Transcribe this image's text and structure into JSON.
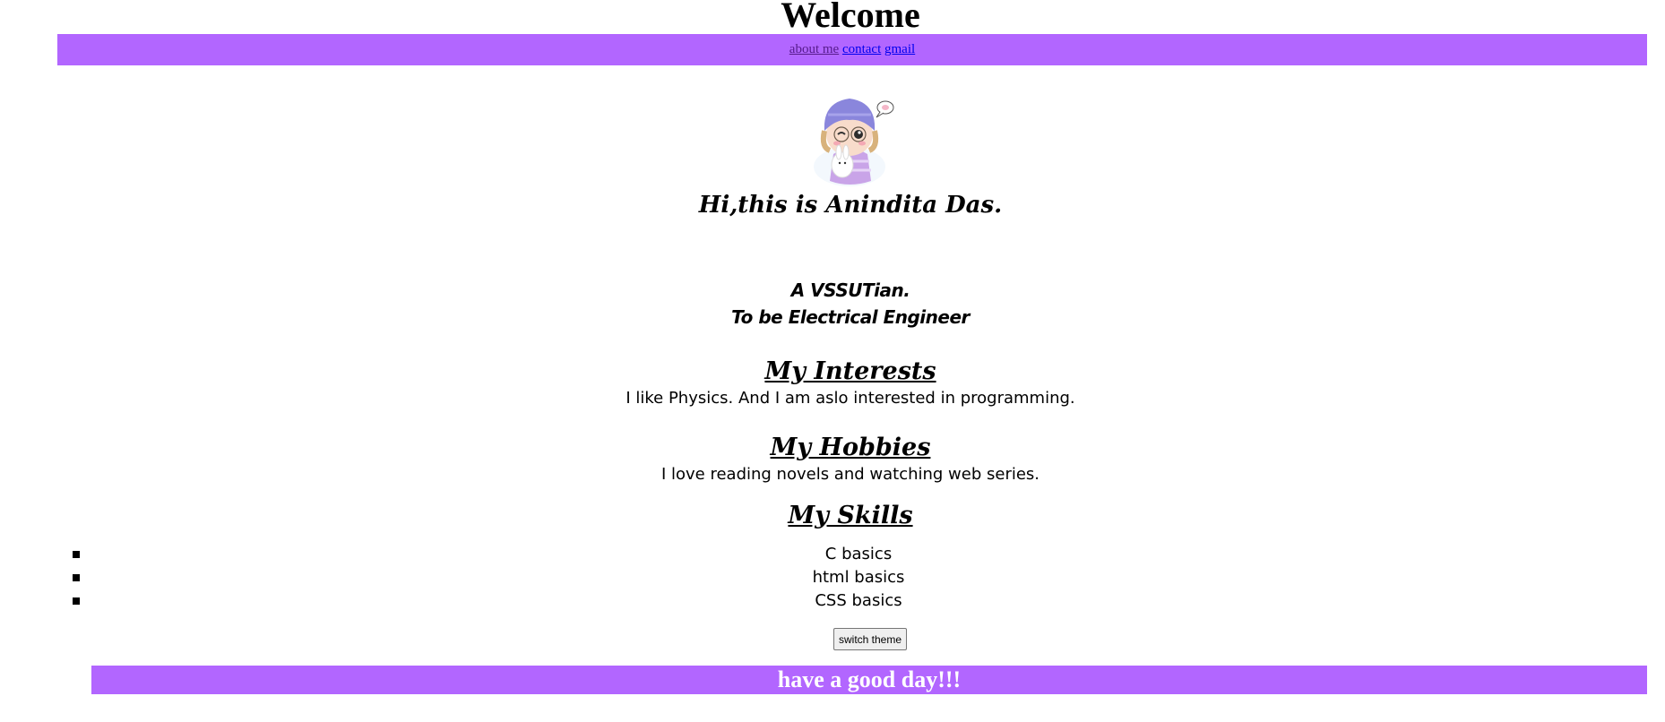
{
  "header": {
    "title": "Welcome"
  },
  "nav": {
    "links": [
      {
        "label": "about me"
      },
      {
        "label": "contact"
      },
      {
        "label": "gmail"
      }
    ]
  },
  "profile": {
    "avatar_icon": "cartoon-girl-avatar",
    "intro": "Hi,this is Anindita Das.",
    "tagline_line1": "A VSSUTian.",
    "tagline_line2": "To be Electrical Engineer"
  },
  "sections": {
    "interests": {
      "heading": "My Interests",
      "body": "I like Physics. And I am aslo interested in programming."
    },
    "hobbies": {
      "heading": "My Hobbies",
      "body": "I love reading novels and watching web series."
    },
    "skills": {
      "heading": "My Skills",
      "items": [
        "C basics",
        "html basics",
        "CSS basics"
      ]
    }
  },
  "controls": {
    "switch_theme_label": "switch theme"
  },
  "footer": {
    "message": "have a good day!!!"
  },
  "colors": {
    "accent": "#b266ff",
    "link": "#0000ee",
    "visited_link": "#551a8b"
  }
}
